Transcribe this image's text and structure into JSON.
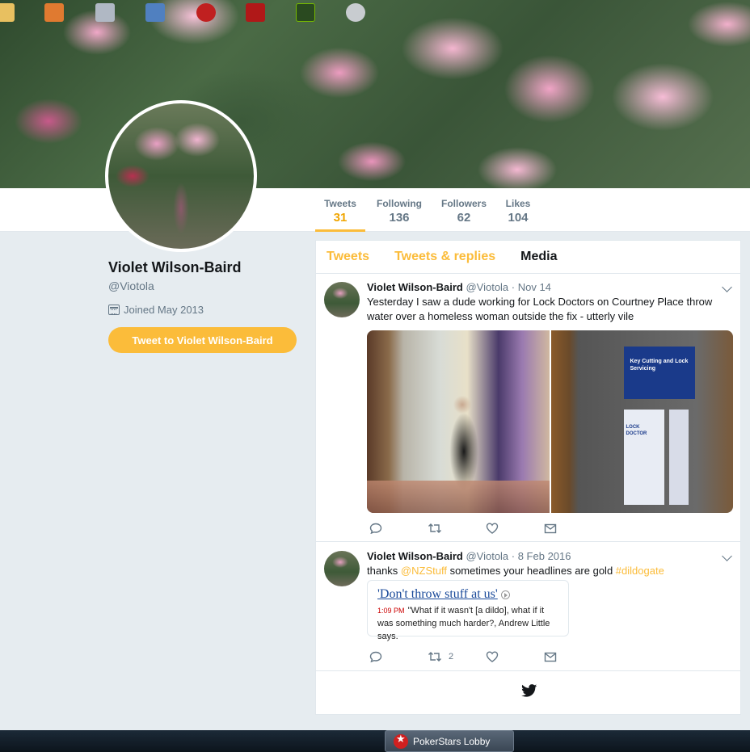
{
  "profile": {
    "name": "Violet Wilson-Baird",
    "handle": "@Viotola",
    "joined": "Joined May 2013",
    "tweet_to_label": "Tweet to Violet Wilson-Baird"
  },
  "stats": [
    {
      "label": "Tweets",
      "value": "31"
    },
    {
      "label": "Following",
      "value": "136"
    },
    {
      "label": "Followers",
      "value": "62"
    },
    {
      "label": "Likes",
      "value": "104"
    }
  ],
  "tabs": [
    "Tweets",
    "Tweets & replies",
    "Media"
  ],
  "tweets": [
    {
      "name": "Violet Wilson-Baird",
      "meta": "@Viotola · Nov 14",
      "text": "Yesterday I saw a dude working for Lock Doctors on Courtney Place throw water over a homeless woman outside the fix - utterly vile",
      "retweets": "",
      "sign_text": "Key Cutting and Lock Servicing",
      "brand_text": "LOCK DOCTOR"
    },
    {
      "name": "Violet Wilson-Baird",
      "meta": "@Viotola · 8 Feb 2016",
      "text_pre": "thanks ",
      "mention": "@NZStuff",
      "text_mid": " sometimes your headlines are gold ",
      "hashtag": "#dildogate",
      "retweets": "2",
      "quote": {
        "title": "'Don't throw stuff at us'",
        "time": "1:09 PM",
        "body": "\"What if it wasn't [a dildo], what if it was something much harder?, Andrew Little says."
      }
    }
  ],
  "taskbar": {
    "active_task": "PokerStars Lobby"
  },
  "colors": {
    "accent": "#fbbc3a",
    "text": "#14171a",
    "muted": "#657786",
    "background": "#e6ecf0"
  }
}
